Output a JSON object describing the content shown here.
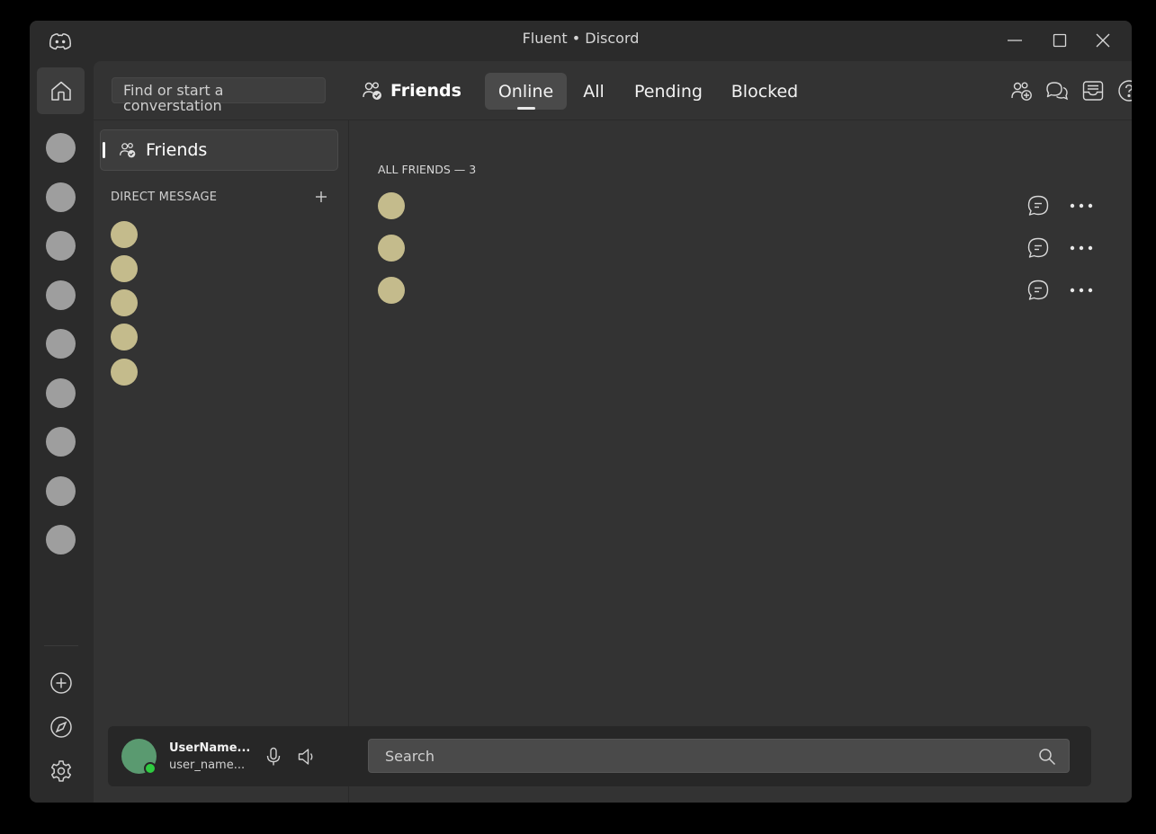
{
  "window": {
    "title": "Fluent • Discord"
  },
  "search": {
    "find_placeholder": "Find or start a converstation",
    "bottom_placeholder": "Search"
  },
  "header": {
    "friends_label": "Friends",
    "tabs": [
      {
        "label": "Online",
        "active": true
      },
      {
        "label": "All",
        "active": false
      },
      {
        "label": "Pending",
        "active": false
      },
      {
        "label": "Blocked",
        "active": false
      }
    ]
  },
  "sidebar": {
    "friends_label": "Friends",
    "direct_message_header": "DIRECT MESSAGE",
    "dm_count": 5
  },
  "content": {
    "section_title": "ALL FRIENDS — 3",
    "friend_count": 3
  },
  "user": {
    "name": "UserName...",
    "handle": "user_name...",
    "status": "online"
  },
  "colors": {
    "avatar_placeholder": "#c4bb8c",
    "server_placeholder": "#9e9e9e",
    "user_avatar": "#5a9a70",
    "status_online": "#2ecc40"
  },
  "icons": {
    "titlebar": [
      "discord-logo-icon",
      "minimize-icon",
      "maximize-icon",
      "close-icon"
    ],
    "rail": [
      "home-icon",
      "add-server-icon",
      "explore-icon",
      "settings-icon"
    ],
    "top_right": [
      "add-friend-icon",
      "new-group-dm-icon",
      "inbox-icon",
      "help-icon"
    ],
    "row": [
      "message-icon",
      "more-icon"
    ],
    "bottom": [
      "microphone-icon",
      "speaker-icon",
      "search-icon"
    ]
  }
}
